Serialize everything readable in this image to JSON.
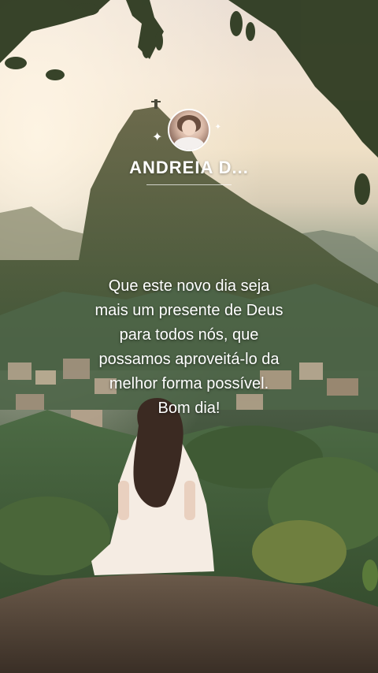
{
  "profile": {
    "name": "ANDREIA  D...",
    "avatar_icon": "profile-photo"
  },
  "message": {
    "lines": [
      "Que este novo dia seja",
      "mais um presente de Deus",
      "para todos nós, que",
      "possamos aproveitá-lo da",
      "melhor forma possível.",
      "Bom dia!"
    ]
  },
  "colors": {
    "text": "#ffffff",
    "sky": "#f1e3d2",
    "foliage": "#3e5236"
  }
}
